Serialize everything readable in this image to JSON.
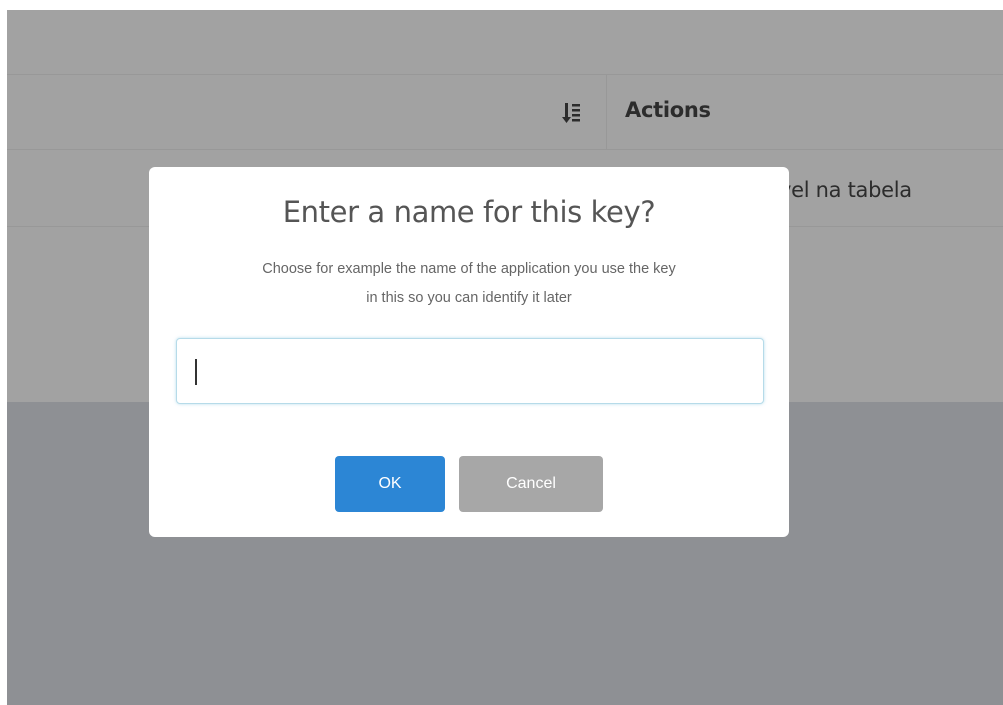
{
  "table": {
    "actions_header": "Actions",
    "row1_partial_text": "vel na tabela",
    "sort_icon": "sort-amount-icon"
  },
  "dialog": {
    "title": "Enter a name for this key?",
    "description_line1": "Choose for example the name of the application you use the key",
    "description_line2": "in this so you can identify it later",
    "input_value": "",
    "ok_label": "OK",
    "cancel_label": "Cancel"
  },
  "colors": {
    "ok_button": "#2c86d5",
    "cancel_button": "#a7a7a7",
    "overlay": "#8e9094",
    "input_border": "#b6dbe9"
  }
}
